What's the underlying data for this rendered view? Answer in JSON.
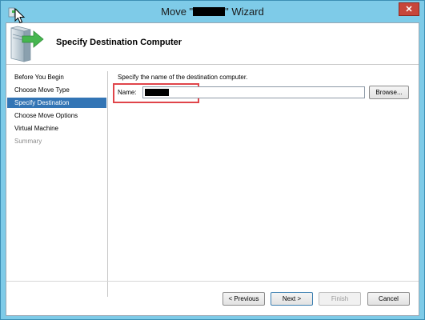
{
  "window": {
    "title_prefix": "Move \"",
    "title_suffix": "\" Wizard",
    "close_label": "✕"
  },
  "header": {
    "title": "Specify Destination Computer"
  },
  "nav": {
    "items": [
      {
        "label": "Before You Begin",
        "state": "normal"
      },
      {
        "label": "Choose Move Type",
        "state": "normal"
      },
      {
        "label": "Specify Destination",
        "state": "active"
      },
      {
        "label": "Choose Move Options",
        "state": "normal"
      },
      {
        "label": "Virtual Machine",
        "state": "normal"
      },
      {
        "label": "Summary",
        "state": "disabled"
      }
    ]
  },
  "main": {
    "instruction": "Specify the name of the destination computer.",
    "name_label": "Name:",
    "browse_label": "Browse..."
  },
  "footer": {
    "previous_label": "< Previous",
    "next_label": "Next >",
    "finish_label": "Finish",
    "cancel_label": "Cancel"
  },
  "colors": {
    "title_bar": "#7ecbe8",
    "selection": "#3375b5",
    "highlight_box": "#e0454a",
    "close_button": "#c7463a"
  },
  "icons": {
    "window": "wizard-app-icon",
    "header": "server-move-arrow-icon",
    "pointer": "mouse-cursor-icon"
  }
}
